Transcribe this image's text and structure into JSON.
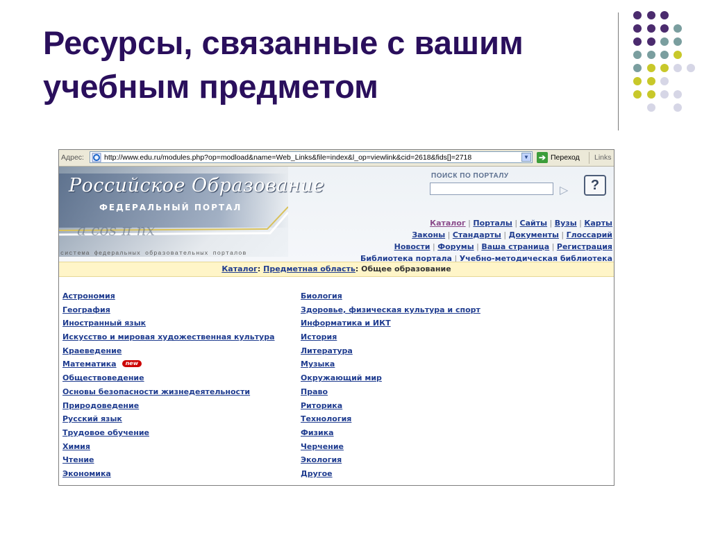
{
  "slide": {
    "title": "Ресурсы, связанные с вашим учебным предметом",
    "dot_colors": {
      "purple": "#4b2b6e",
      "teal": "#7a9e9f",
      "olive": "#c8c82a",
      "lavender": "#d6d6e6"
    }
  },
  "browser": {
    "address_label": "Адрес:",
    "url": "http://www.edu.ru/modules.php?op=modload&name=Web_Links&file=index&l_op=viewlink&cid=2618&fids[]=2718",
    "go_label": "Переход",
    "links_label": "Links"
  },
  "site": {
    "logo": "Российское Образование",
    "logo_sub": "ФЕДЕРАЛЬНЫЙ ПОРТАЛ",
    "caption": "система федеральных образовательных порталов",
    "search_title": "ПОИСК ПО ПОРТАЛУ",
    "help": "?",
    "nav": {
      "row1": [
        "Каталог",
        "Порталы",
        "Сайты",
        "Вузы",
        "Карты"
      ],
      "row2": [
        "Законы",
        "Стандарты",
        "Документы",
        "Глоссарий"
      ],
      "row3": [
        "Новости",
        "Форумы",
        "Ваша страница",
        "Регистрация"
      ],
      "row4": [
        "Библиотека портала",
        "Учебно-методическая библиотека"
      ]
    },
    "breadcrumb": {
      "link1": "Каталог",
      "sep1": ": ",
      "link2": "Предметная область",
      "sep2": ": ",
      "current": "Общее образование"
    },
    "new_badge": "new",
    "categories_left": [
      "Астрономия",
      "География",
      "Иностранный язык",
      "Искусство и мировая художественная культура",
      "Краеведение",
      "Математика",
      "Обществоведение",
      "Основы безопасности жизнедеятельности",
      "Природоведение",
      "Русский язык",
      "Трудовое обучение",
      "Химия",
      "Чтение",
      "Экономика"
    ],
    "categories_right": [
      "Биология",
      "Здоровье, физическая культура и спорт",
      "Информатика и ИКТ",
      "История",
      "Литература",
      "Музыка",
      "Окружающий мир",
      "Право",
      "Риторика",
      "Технология",
      "Физика",
      "Черчение",
      "Экология",
      "Другое"
    ]
  }
}
